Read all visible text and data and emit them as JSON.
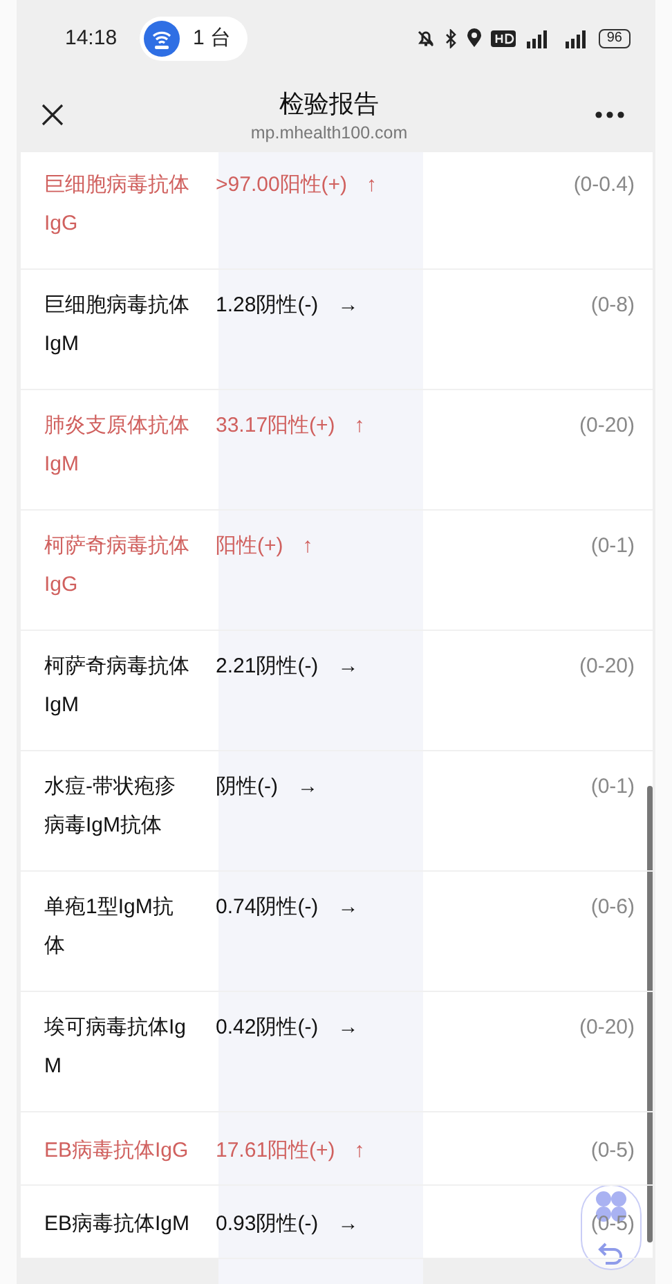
{
  "status_bar": {
    "time": "14:18",
    "hotspot_count": "1 台",
    "battery": "96"
  },
  "header": {
    "title": "检验报告",
    "url": "mp.mhealth100.com"
  },
  "rows": [
    {
      "name": "巨细胞病毒抗体IgG",
      "value": ">97.00阳性(+)",
      "arrow": "↑",
      "range": "(0-0.4)",
      "abnormal": true
    },
    {
      "name": "巨细胞病毒抗体IgM",
      "value": "1.28阴性(-)",
      "arrow": "→",
      "range": "(0-8)",
      "abnormal": false
    },
    {
      "name": "肺炎支原体抗体IgM",
      "value": "33.17阳性(+)",
      "arrow": "↑",
      "range": "(0-20)",
      "abnormal": true
    },
    {
      "name": "柯萨奇病毒抗体IgG",
      "value": "阳性(+)",
      "arrow": "↑",
      "range": "(0-1)",
      "abnormal": true
    },
    {
      "name": "柯萨奇病毒抗体IgM",
      "value": "2.21阴性(-)",
      "arrow": "→",
      "range": "(0-20)",
      "abnormal": false
    },
    {
      "name": "水痘-带状疱疹病毒IgM抗体",
      "value": "阴性(-)",
      "arrow": "→",
      "range": "(0-1)",
      "abnormal": false
    },
    {
      "name": "单疱1型IgM抗体",
      "value": "0.74阴性(-)",
      "arrow": "→",
      "range": "(0-6)",
      "abnormal": false
    },
    {
      "name": "埃可病毒抗体IgM",
      "value": "0.42阴性(-)",
      "arrow": "→",
      "range": "(0-20)",
      "abnormal": false
    },
    {
      "name": "EB病毒抗体IgG",
      "value": "17.61阳性(+)",
      "arrow": "↑",
      "range": "(0-5)",
      "abnormal": true
    },
    {
      "name": "EB病毒抗体IgM",
      "value": "0.93阴性(-)",
      "arrow": "→",
      "range": "(0-5)",
      "abnormal": false
    }
  ]
}
